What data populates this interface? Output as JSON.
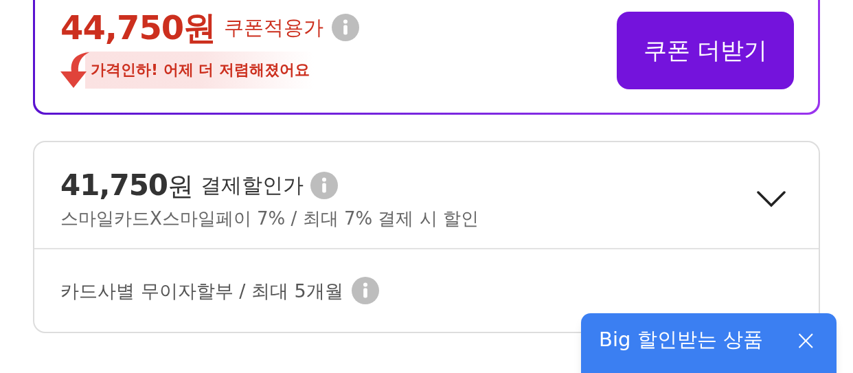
{
  "coupon_price": {
    "amount": "44,750",
    "unit": "원",
    "label": "쿠폰적용가",
    "badge": "가격인하! 어제 더 저렴해졌어요",
    "button": "쿠폰 더받기"
  },
  "payment_discount": {
    "amount": "41,750",
    "unit": "원",
    "label": "결제할인가",
    "detail": "스마일카드X스마일페이 7% / 최대 7% 결제 시 할인",
    "expanded": false
  },
  "installment": {
    "text": "카드사별 무이자할부 / 최대 5개월"
  },
  "popup": {
    "title": "Big 할인받는 상품",
    "close": "×"
  }
}
